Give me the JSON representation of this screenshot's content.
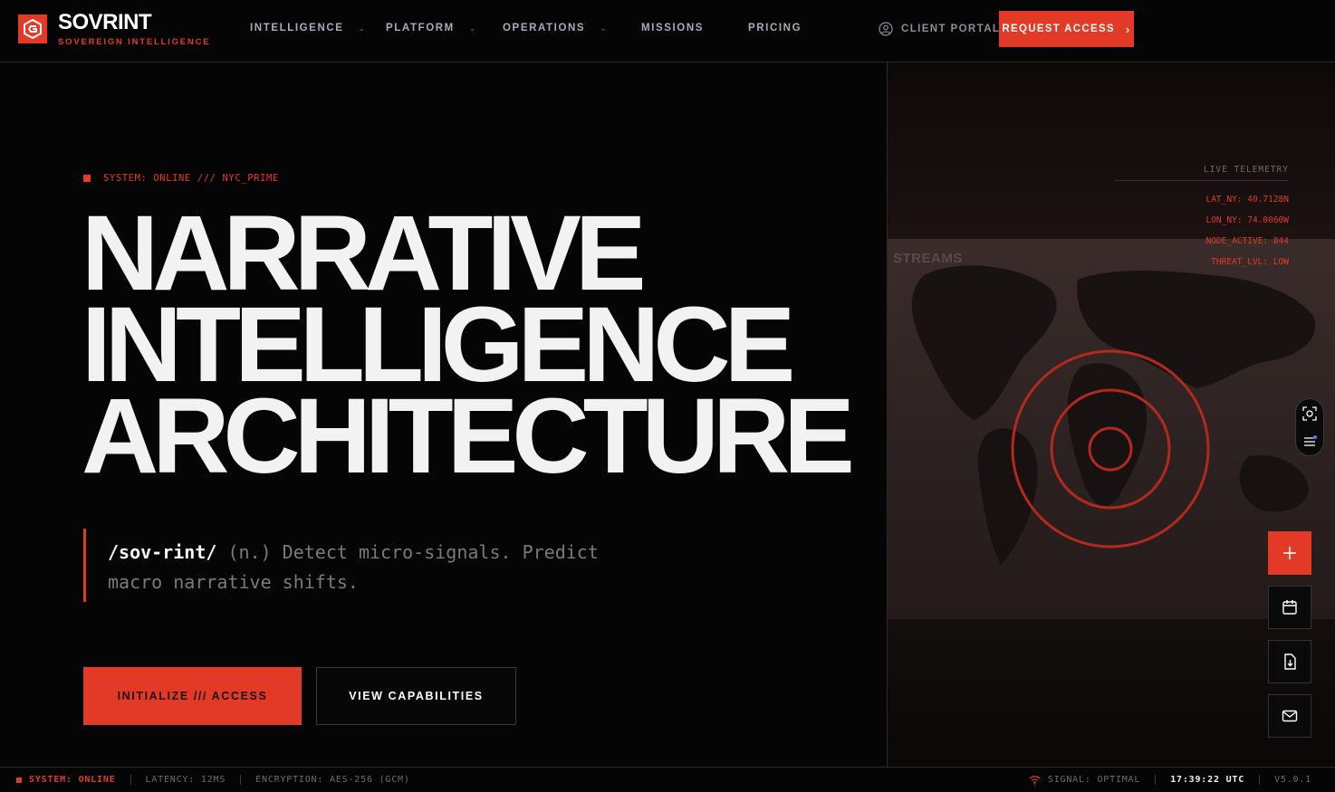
{
  "brand": {
    "name": "SOVRINT",
    "tagline": "SOVEREIGN INTELLIGENCE",
    "logo_icon": "shield-logo-icon"
  },
  "nav": {
    "items": [
      {
        "label": "INTELLIGENCE",
        "has_dropdown": true
      },
      {
        "label": "PLATFORM",
        "has_dropdown": true
      },
      {
        "label": "OPERATIONS",
        "has_dropdown": true
      },
      {
        "label": "MISSIONS",
        "has_dropdown": false
      },
      {
        "label": "PRICING",
        "has_dropdown": false
      }
    ],
    "client_portal": "CLIENT PORTAL",
    "request_access": "REQUEST ACCESS"
  },
  "hero": {
    "status": "SYSTEM: ONLINE /// NYC_PRIME",
    "headline": [
      "NARRATIVE",
      "INTELLIGENCE",
      "ARCHITECTURE"
    ],
    "definition_term": "/sov-rint/",
    "definition_rest": " (n.) Detect micro-signals. Predict macro narrative shifts.",
    "primary_cta": "INITIALIZE /// ACCESS",
    "secondary_cta": "VIEW CAPABILITIES"
  },
  "telemetry": {
    "title": "LIVE TELEMETRY",
    "rows": [
      "LAT_NY: 40.7128N",
      "LON_NY: 74.0060W",
      "NODE_ACTIVE: 844",
      "THREAT_LVL: LOW"
    ],
    "screen_label": "STREAMS"
  },
  "footer": {
    "system": "SYSTEM: ONLINE",
    "latency": "LATENCY: 12MS",
    "encryption": "ENCRYPTION: AES-256 (GCM)",
    "signal": "SIGNAL: OPTIMAL",
    "time": "17:39:22 UTC",
    "version": "V5.0.1"
  },
  "colors": {
    "accent": "#e23a26",
    "background": "#050505",
    "text": "#f2f2f2"
  }
}
